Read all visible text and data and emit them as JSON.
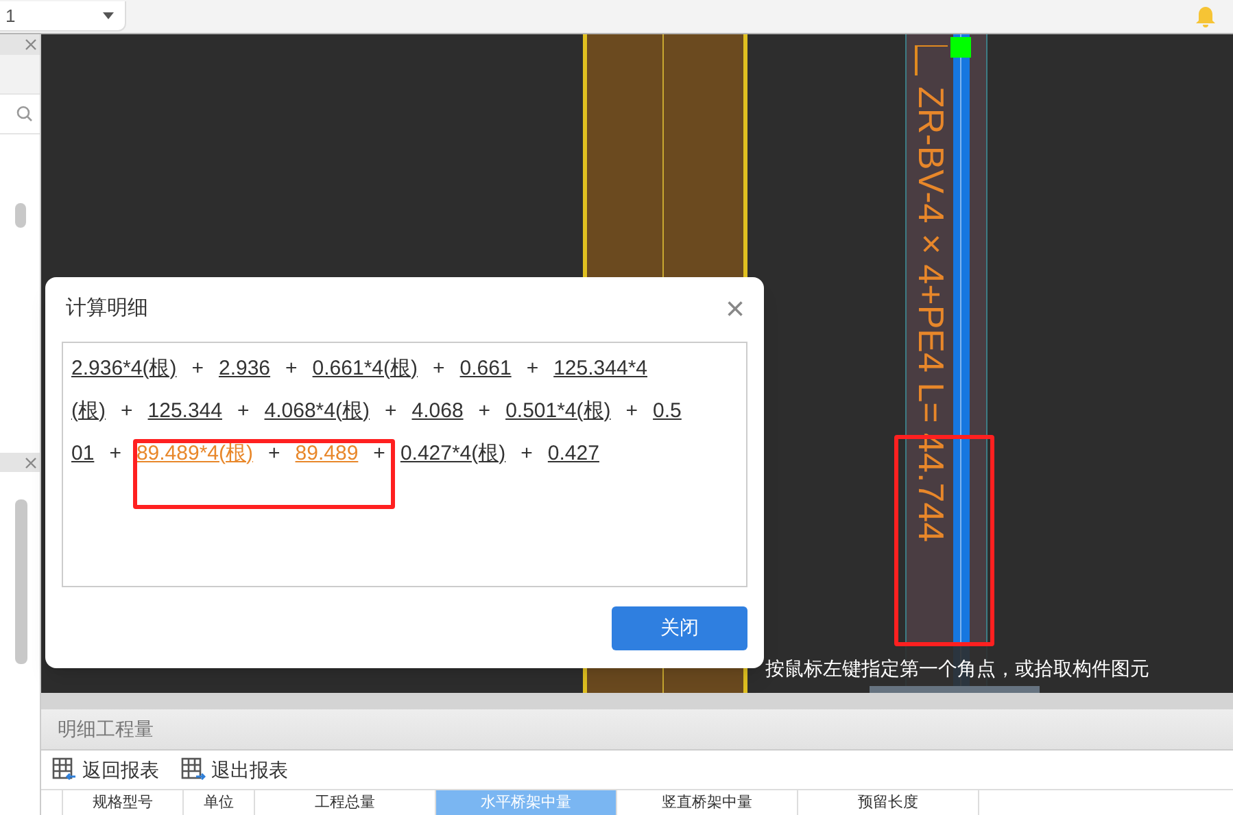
{
  "top_bar": {
    "floor_select": "1"
  },
  "canvas": {
    "cable_label": "ZR-BV-4×4+PE4 L= 44.744",
    "hint": "按鼠标左键指定第一个角点，或拾取构件图元"
  },
  "dialog": {
    "title": "计算明细",
    "close": "×",
    "lines": [
      [
        {
          "kind": "term",
          "text": "2.936*4(根)",
          "highlighted": false
        },
        {
          "kind": "operator",
          "text": "+"
        },
        {
          "kind": "term",
          "text": "2.936",
          "highlighted": false
        },
        {
          "kind": "operator",
          "text": "+"
        },
        {
          "kind": "term",
          "text": "0.661*4(根)",
          "highlighted": false
        },
        {
          "kind": "operator",
          "text": "+"
        },
        {
          "kind": "term",
          "text": "0.661",
          "highlighted": false
        },
        {
          "kind": "operator",
          "text": "+"
        },
        {
          "kind": "term",
          "text": "125.344*4",
          "highlighted": false
        }
      ],
      [
        {
          "kind": "term",
          "text": "(根)",
          "highlighted": false
        },
        {
          "kind": "operator",
          "text": "+"
        },
        {
          "kind": "term",
          "text": "125.344",
          "highlighted": false
        },
        {
          "kind": "operator",
          "text": "+"
        },
        {
          "kind": "term",
          "text": "4.068*4(根)",
          "highlighted": false
        },
        {
          "kind": "operator",
          "text": "+"
        },
        {
          "kind": "term",
          "text": "4.068",
          "highlighted": false
        },
        {
          "kind": "operator",
          "text": "+"
        },
        {
          "kind": "term",
          "text": "0.501*4(根)",
          "highlighted": false
        },
        {
          "kind": "operator",
          "text": "+"
        },
        {
          "kind": "term",
          "text": "0.5",
          "highlighted": false
        }
      ],
      [
        {
          "kind": "term",
          "text": "01",
          "highlighted": false
        },
        {
          "kind": "operator",
          "text": "+"
        },
        {
          "kind": "term",
          "text": "89.489*4(根)",
          "highlighted": true
        },
        {
          "kind": "operator",
          "text": "+"
        },
        {
          "kind": "term",
          "text": "89.489",
          "highlighted": true
        },
        {
          "kind": "operator",
          "text": "+"
        },
        {
          "kind": "term",
          "text": "0.427*4(根)",
          "highlighted": false
        },
        {
          "kind": "operator",
          "text": "+"
        },
        {
          "kind": "term",
          "text": "0.427",
          "highlighted": false
        }
      ]
    ],
    "button": "关闭"
  },
  "bottom_panel": {
    "title": "明细工程量",
    "toolbar": [
      "返回报表",
      "退出报表"
    ],
    "columns": [
      {
        "label": "规格型号",
        "selected": false
      },
      {
        "label": "单位",
        "selected": false
      },
      {
        "label": "工程总量",
        "selected": false
      },
      {
        "label": "水平桥架中量",
        "selected": true
      },
      {
        "label": "竖直桥架中量",
        "selected": false
      },
      {
        "label": "预留长度",
        "selected": false
      }
    ]
  }
}
